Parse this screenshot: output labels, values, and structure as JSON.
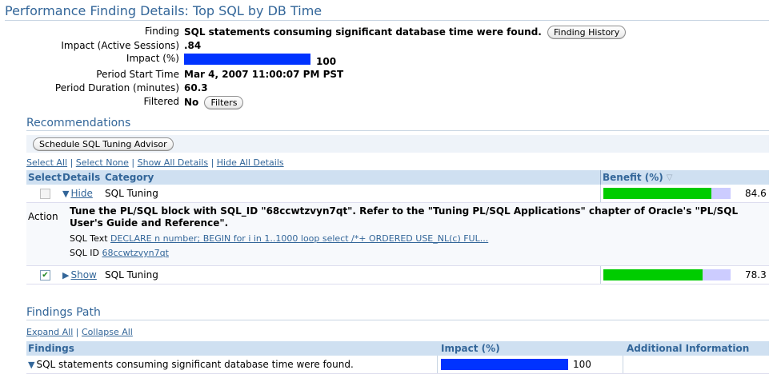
{
  "title": "Performance Finding Details: Top SQL by DB Time",
  "finding": {
    "label": "Finding",
    "value": "SQL statements consuming significant database time were found.",
    "button": "Finding History"
  },
  "impact_sessions": {
    "label": "Impact (Active Sessions)",
    "value": ".84"
  },
  "impact_pct": {
    "label": "Impact (%)",
    "value": "100",
    "fraction": 1.0,
    "color": "#0033ff"
  },
  "period_start": {
    "label": "Period Start Time",
    "value": "Mar 4, 2007 11:00:07 PM PST"
  },
  "period_duration": {
    "label": "Period Duration (minutes)",
    "value": "60.3"
  },
  "filtered": {
    "label": "Filtered",
    "value": "No",
    "button": "Filters"
  },
  "recommendations": {
    "title": "Recommendations",
    "schedule_button": "Schedule SQL Tuning Advisor",
    "select_all": "Select All",
    "select_none": "Select None",
    "show_all": "Show All Details",
    "hide_all": "Hide All Details",
    "columns": {
      "select": "Select",
      "details": "Details",
      "category": "Category",
      "benefit": "Benefit (%)"
    },
    "rows": [
      {
        "details_link": "Hide",
        "category": "SQL Tuning",
        "benefit": "84.6",
        "benefit_fraction": 0.846,
        "checked": false,
        "action_label": "Action",
        "action_text": "Tune the PL/SQL block with SQL_ID \"68ccwtzvyn7qt\". Refer to the \"Tuning PL/SQL Applications\" chapter of Oracle's \"PL/SQL User's Guide and Reference\".",
        "sql_text_label": "SQL Text",
        "sql_text": "DECLARE n number; BEGIN for i in 1..1000 loop select /*+ ORDERED USE_NL(c) FUL...",
        "sql_id_label": "SQL ID",
        "sql_id": "68ccwtzvyn7qt"
      },
      {
        "details_link": "Show",
        "category": "SQL Tuning",
        "benefit": "78.3",
        "benefit_fraction": 0.783,
        "checked": true
      }
    ],
    "bar_color": "#00cc00",
    "bar_bg": "#ccccff"
  },
  "findings_path": {
    "title": "Findings Path",
    "expand_all": "Expand All",
    "collapse_all": "Collapse All",
    "columns": {
      "findings": "Findings",
      "impact": "Impact (%)",
      "additional": "Additional Information"
    },
    "rows": [
      {
        "finding": "SQL statements consuming significant database time were found.",
        "impact": "100",
        "impact_fraction": 1.0
      }
    ]
  }
}
